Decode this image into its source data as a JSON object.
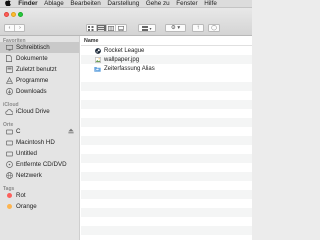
{
  "menubar": {
    "apple_icon": "apple-icon",
    "items": [
      "Finder",
      "Ablage",
      "Bearbeiten",
      "Darstellung",
      "Gehe zu",
      "Fenster",
      "Hilfe"
    ]
  },
  "toolbar": {
    "back_glyph": "‹",
    "forward_glyph": "›",
    "view_buttons": [
      "icon-view",
      "list-view",
      "column-view",
      "gallery-view"
    ],
    "active_view": "list-view",
    "group_glyph": "▾",
    "action_glyph": "⚙ ▾",
    "share_glyph": "↑",
    "tag_glyph": "◯"
  },
  "sidebar": {
    "favorites_title": "Favoriten",
    "favorites": [
      {
        "label": "Schreibtisch",
        "icon": "desktop-icon",
        "selected": true
      },
      {
        "label": "Dokumente",
        "icon": "documents-icon"
      },
      {
        "label": "Zuletzt benutzt",
        "icon": "recents-icon"
      },
      {
        "label": "Programme",
        "icon": "applications-icon"
      },
      {
        "label": "Downloads",
        "icon": "downloads-icon"
      }
    ],
    "icloud_title": "iCloud",
    "icloud": [
      {
        "label": "iCloud Drive",
        "icon": "cloud-icon"
      }
    ],
    "places_title": "Orte",
    "places": [
      {
        "label": "C",
        "icon": "disk-icon",
        "eject": true
      },
      {
        "label": "Macintosh HD",
        "icon": "disk-icon"
      },
      {
        "label": "Untitled",
        "icon": "disk-icon"
      },
      {
        "label": "Entfernte CD/DVD",
        "icon": "disc-icon"
      },
      {
        "label": "Netzwerk",
        "icon": "network-icon"
      }
    ],
    "tags_title": "Tags",
    "tags": [
      {
        "label": "Rot",
        "color": "#fc605c"
      },
      {
        "label": "Orange",
        "color": "#fdb44f"
      }
    ]
  },
  "main": {
    "column_name": "Name",
    "files": [
      {
        "name": "Rocket League",
        "icon": "steam-icon"
      },
      {
        "name": "wallpaper.jpg",
        "icon": "image-file-icon"
      },
      {
        "name": "Zeiterfassung Alias",
        "icon": "alias-icon"
      }
    ]
  },
  "colors": {
    "selection": "#c9c9c9",
    "sidebar_bg": "#e4e4e4",
    "close": "#ff5f57",
    "minimize": "#ffbd2e",
    "maximize": "#28c940"
  }
}
